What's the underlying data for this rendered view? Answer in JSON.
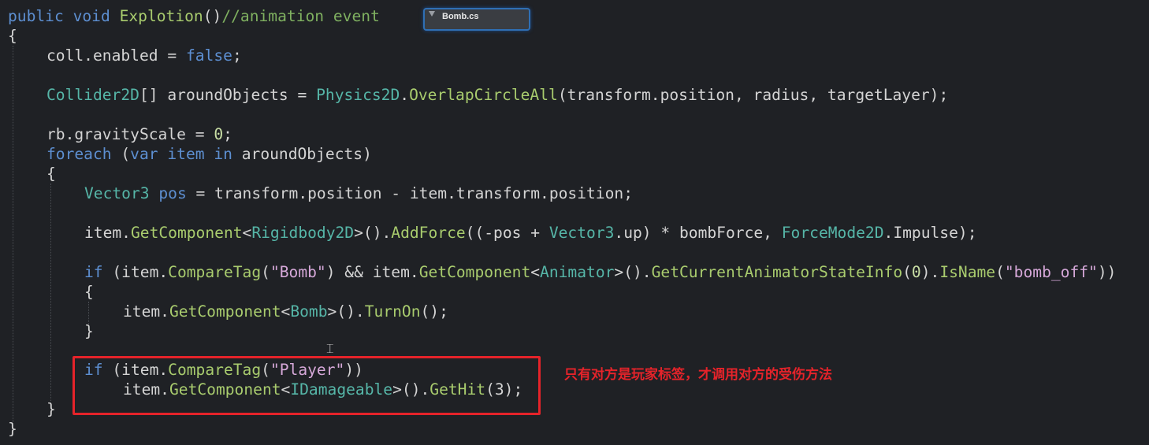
{
  "file_tab": {
    "name": "Bomb.cs"
  },
  "code": {
    "l1_a": "public",
    "l1_b": "void",
    "l1_c": "Explotion",
    "l1_d": "()",
    "l1_e": "//animation event",
    "l2": "{",
    "l3_a": "coll.enabled = ",
    "l3_b": "false",
    "l3_c": ";",
    "l4_a": "Collider2D",
    "l4_b": "[] aroundObjects = ",
    "l4_c": "Physics2D",
    "l4_d": ".",
    "l4_e": "OverlapCircleAll",
    "l4_f": "(transform.position, radius, targetLayer);",
    "l5_a": "rb.gravityScale = ",
    "l5_b": "0",
    "l5_c": ";",
    "l6_a": "foreach",
    "l6_b": " (",
    "l6_c": "var",
    "l6_d": " item ",
    "l6_e": "in",
    "l6_f": " aroundObjects)",
    "l7": "{",
    "l8_a": "Vector3",
    "l8_b": " pos",
    "l8_c": " = transform.position - item.transform.position;",
    "l9_a": "item.",
    "l9_b": "GetComponent",
    "l9_c": "<",
    "l9_d": "Rigidbody2D",
    "l9_e": ">().",
    "l9_f": "AddForce",
    "l9_g": "((-pos + ",
    "l9_h": "Vector3",
    "l9_i": ".up) * bombForce, ",
    "l9_j": "ForceMode2D",
    "l9_k": ".Impulse);",
    "l10_a": "if",
    "l10_b": " (item.",
    "l10_c": "CompareTag",
    "l10_d": "(",
    "l10_e": "\"Bomb\"",
    "l10_f": ") && item.",
    "l10_g": "GetComponent",
    "l10_h": "<",
    "l10_i": "Animator",
    "l10_j": ">().",
    "l10_k": "GetCurrentAnimatorStateInfo",
    "l10_l": "(",
    "l10_m": "0",
    "l10_n": ").",
    "l10_o": "IsName",
    "l10_p": "(",
    "l10_q": "\"bomb_off\"",
    "l10_r": "))",
    "l11": "{",
    "l12_a": "item.",
    "l12_b": "GetComponent",
    "l12_c": "<",
    "l12_d": "Bomb",
    "l12_e": ">().",
    "l12_f": "TurnOn",
    "l12_g": "();",
    "l13": "}",
    "l14_a": "if",
    "l14_b": " (item.",
    "l14_c": "CompareTag",
    "l14_d": "(",
    "l14_e": "\"Player\"",
    "l14_f": "))",
    "l15_a": "item.",
    "l15_b": "GetComponent",
    "l15_c": "<",
    "l15_d": "IDamageable",
    "l15_e": ">().",
    "l15_f": "GetHit",
    "l15_g": "(3);",
    "l16": "}",
    "l17": "}"
  },
  "annotation": {
    "text": "只有对方是玩家标签，才调用对方的受伤方法",
    "color": "#e5232a"
  },
  "colors": {
    "keyword": "#5d8fd1",
    "method": "#a9cc6e",
    "type": "#56b6a8",
    "string": "#d6a8d9",
    "comment": "#7fb060",
    "background": "#1f2125"
  },
  "cursor_icon": "text-cursor-icon"
}
